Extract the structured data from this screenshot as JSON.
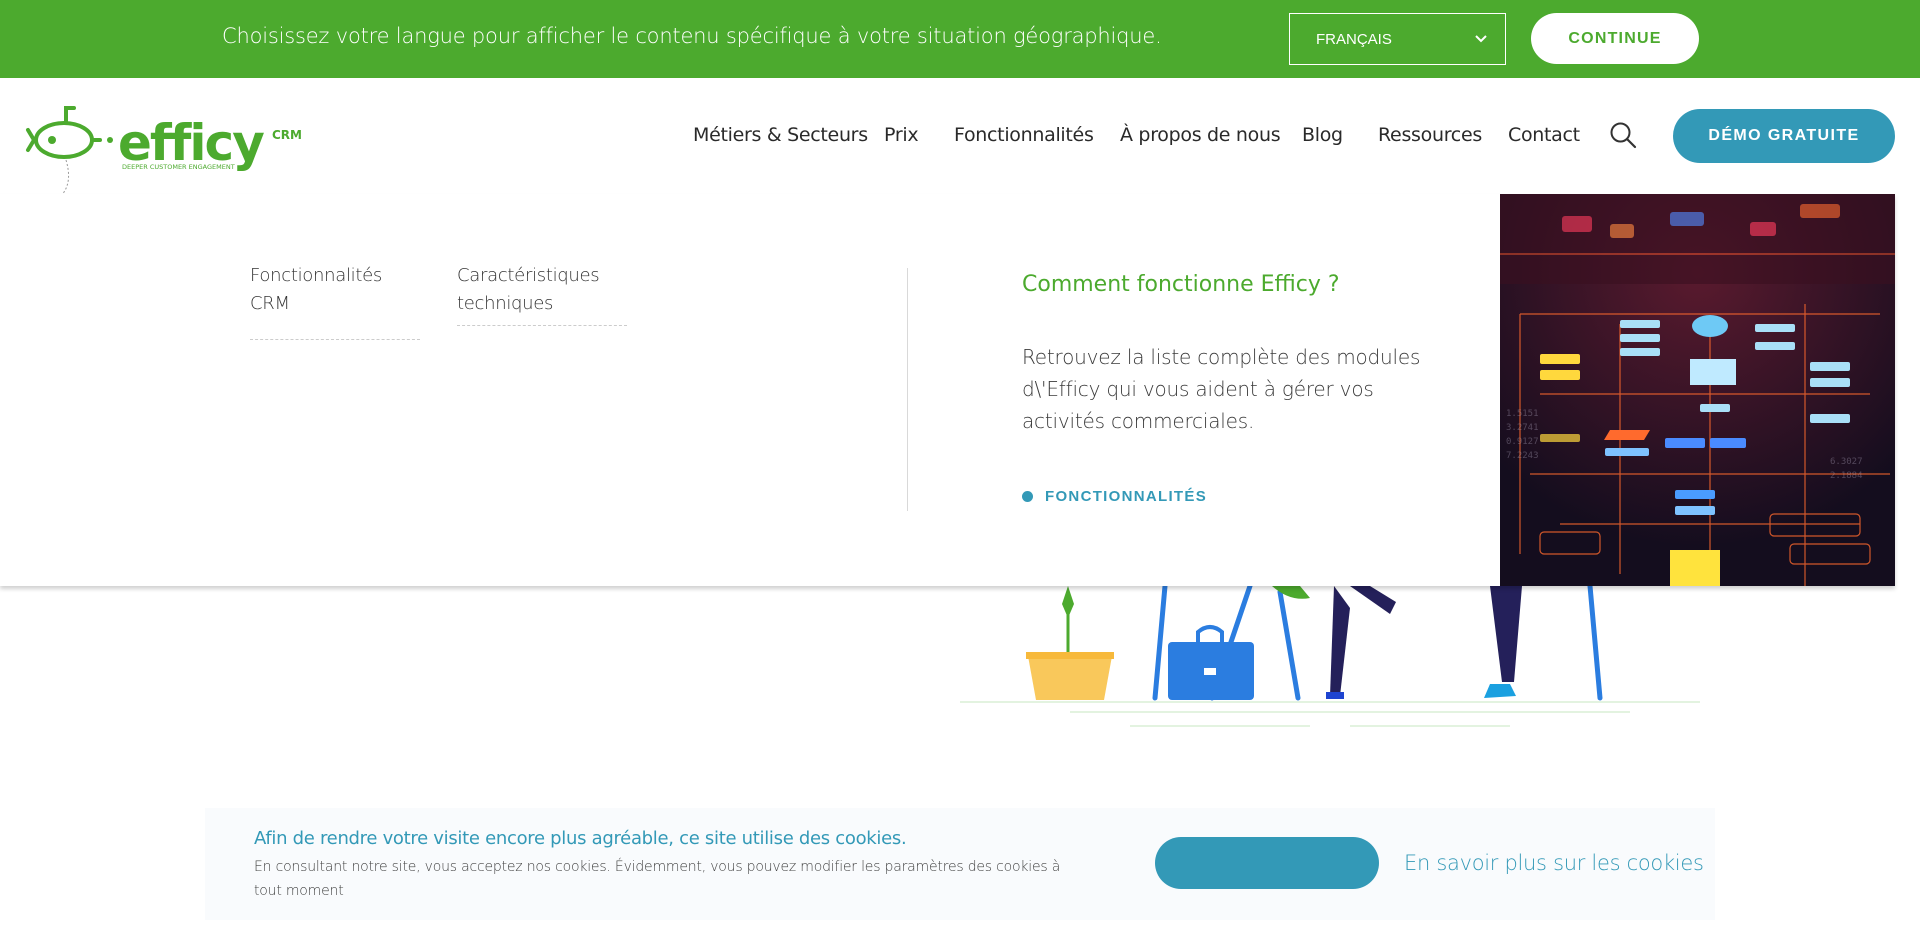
{
  "language_bar": {
    "message": "Choisissez votre langue pour afficher le contenu spécifique à votre situation géographique.",
    "selected_language": "FRANÇAIS",
    "continue_label": "CONTINUE"
  },
  "logo": {
    "name": "efficy",
    "suffix": "CRM",
    "tagline": "DEEPER CUSTOMER ENGAGEMENT"
  },
  "nav": {
    "items": [
      {
        "label": "Métiers & Secteurs"
      },
      {
        "label": "Prix"
      },
      {
        "label": "Fonctionnalités"
      },
      {
        "label": "À propos de nous"
      },
      {
        "label": "Blog"
      },
      {
        "label": "Ressources"
      },
      {
        "label": "Contact"
      }
    ],
    "search_icon": "search-icon",
    "demo_label": "DÉMO GRATUITE"
  },
  "mega_menu": {
    "links": [
      {
        "label": "Fonctionnalités CRM"
      },
      {
        "label": "Caractéristiques techniques"
      }
    ],
    "promo": {
      "title": "Comment fonctionne Efficy ?",
      "text": "Retrouvez la liste complète des modules d\\'Efficy qui vous aident à gérer vos activités commerciales.",
      "link_label": "FONCTIONNALITÉS"
    }
  },
  "cookie_banner": {
    "title": "Afin de rendre votre visite encore plus agréable, ce site utilise des cookies.",
    "text": "En consultant notre site, vous acceptez nos cookies. Évidemment, vous pouvez modifier les paramètres des cookies à tout moment",
    "accept_label": "",
    "more_label": "En savoir plus sur les cookies"
  },
  "colors": {
    "brand_green": "#4caa2e",
    "brand_blue": "#3399b7"
  }
}
